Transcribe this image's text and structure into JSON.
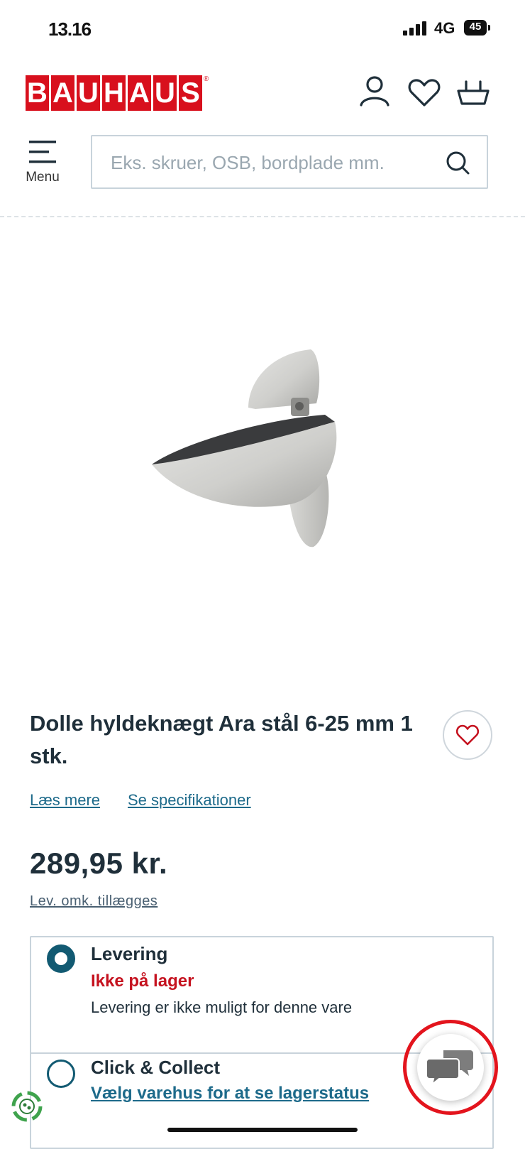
{
  "status_bar": {
    "time": "13.16",
    "network": "4G",
    "battery": "45"
  },
  "header": {
    "logo_letters": [
      "B",
      "A",
      "U",
      "H",
      "A",
      "U",
      "S"
    ],
    "logo_mark": "®",
    "brand_color": "#d8101d"
  },
  "menu": {
    "label": "Menu"
  },
  "search": {
    "placeholder": "Eks. skruer, OSB, bordplade mm."
  },
  "product": {
    "title": "Dolle hyldeknægt Ara stål 6-25 mm 1 stk.",
    "read_more": "Læs mere",
    "specs": "Se specifikationer",
    "price": "289,95 kr.",
    "delivery_cost_note": "Lev. omk. tillægges"
  },
  "delivery_options": [
    {
      "title": "Levering",
      "status": "Ikke på lager",
      "description": "Levering er ikke muligt for denne vare",
      "selected": true
    },
    {
      "title": "Click & Collect",
      "link": "Vælg varehus for at se lagerstatus",
      "selected": false
    }
  ],
  "colors": {
    "accent": "#125a72",
    "link": "#1d6a8a",
    "alert": "#c5121f",
    "chat_ring": "#e3141d"
  },
  "icons": [
    "user-icon",
    "heart-icon",
    "basket-icon",
    "hamburger-icon",
    "search-icon",
    "chat-icon",
    "eco-icon"
  ]
}
